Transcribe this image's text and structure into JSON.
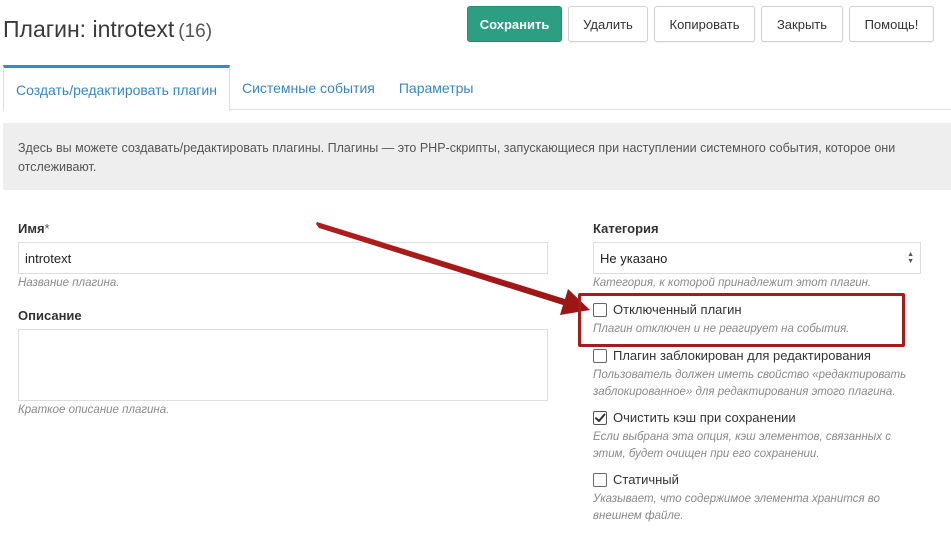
{
  "header": {
    "title": "Плагин: introtext",
    "count": "(16)"
  },
  "toolbar": {
    "save_label": "Сохранить",
    "delete_label": "Удалить",
    "copy_label": "Копировать",
    "close_label": "Закрыть",
    "help_label": "Помощь!",
    "accent_color": "#2e9e82"
  },
  "tabs": [
    {
      "label": "Создать/редактировать плагин",
      "active": true
    },
    {
      "label": "Системные события",
      "active": false
    },
    {
      "label": "Параметры",
      "active": false
    }
  ],
  "info": {
    "text": "Здесь вы можете создавать/редактировать плагины. Плагины — это PHP-скрипты, запускающиеся при наступлении системного события, которое они отслеживают."
  },
  "form": {
    "name": {
      "label": "Имя",
      "required_mark": "*",
      "value": "introtext",
      "hint": "Название плагина."
    },
    "description": {
      "label": "Описание",
      "value": "",
      "hint": "Краткое описание плагина."
    },
    "category": {
      "label": "Категория",
      "selected": "Не указано",
      "hint": "Категория, к которой принадлежит этот плагин."
    },
    "disabled": {
      "label": "Отключенный плагин",
      "checked": false,
      "hint": "Плагин отключен и не реагирует на события."
    },
    "locked": {
      "label": "Плагин заблокирован для редактирования",
      "checked": false,
      "hint_line1": "Пользователь должен иметь свойство «редактировать",
      "hint_line2": "заблокированное» для редактирования этого плагина."
    },
    "clear_cache": {
      "label": "Очистить кэш при сохранении",
      "checked": true,
      "hint_line1": "Если выбрана эта опция, кэш элементов, связанных с",
      "hint_line2": "этим, будет очищен при его сохранении."
    },
    "static": {
      "label": "Статичный",
      "checked": false,
      "hint_line1": "Указывает, что содержимое элемента хранится во",
      "hint_line2": "внешнем файле."
    }
  },
  "annotation": {
    "color": "#a61b1b"
  }
}
